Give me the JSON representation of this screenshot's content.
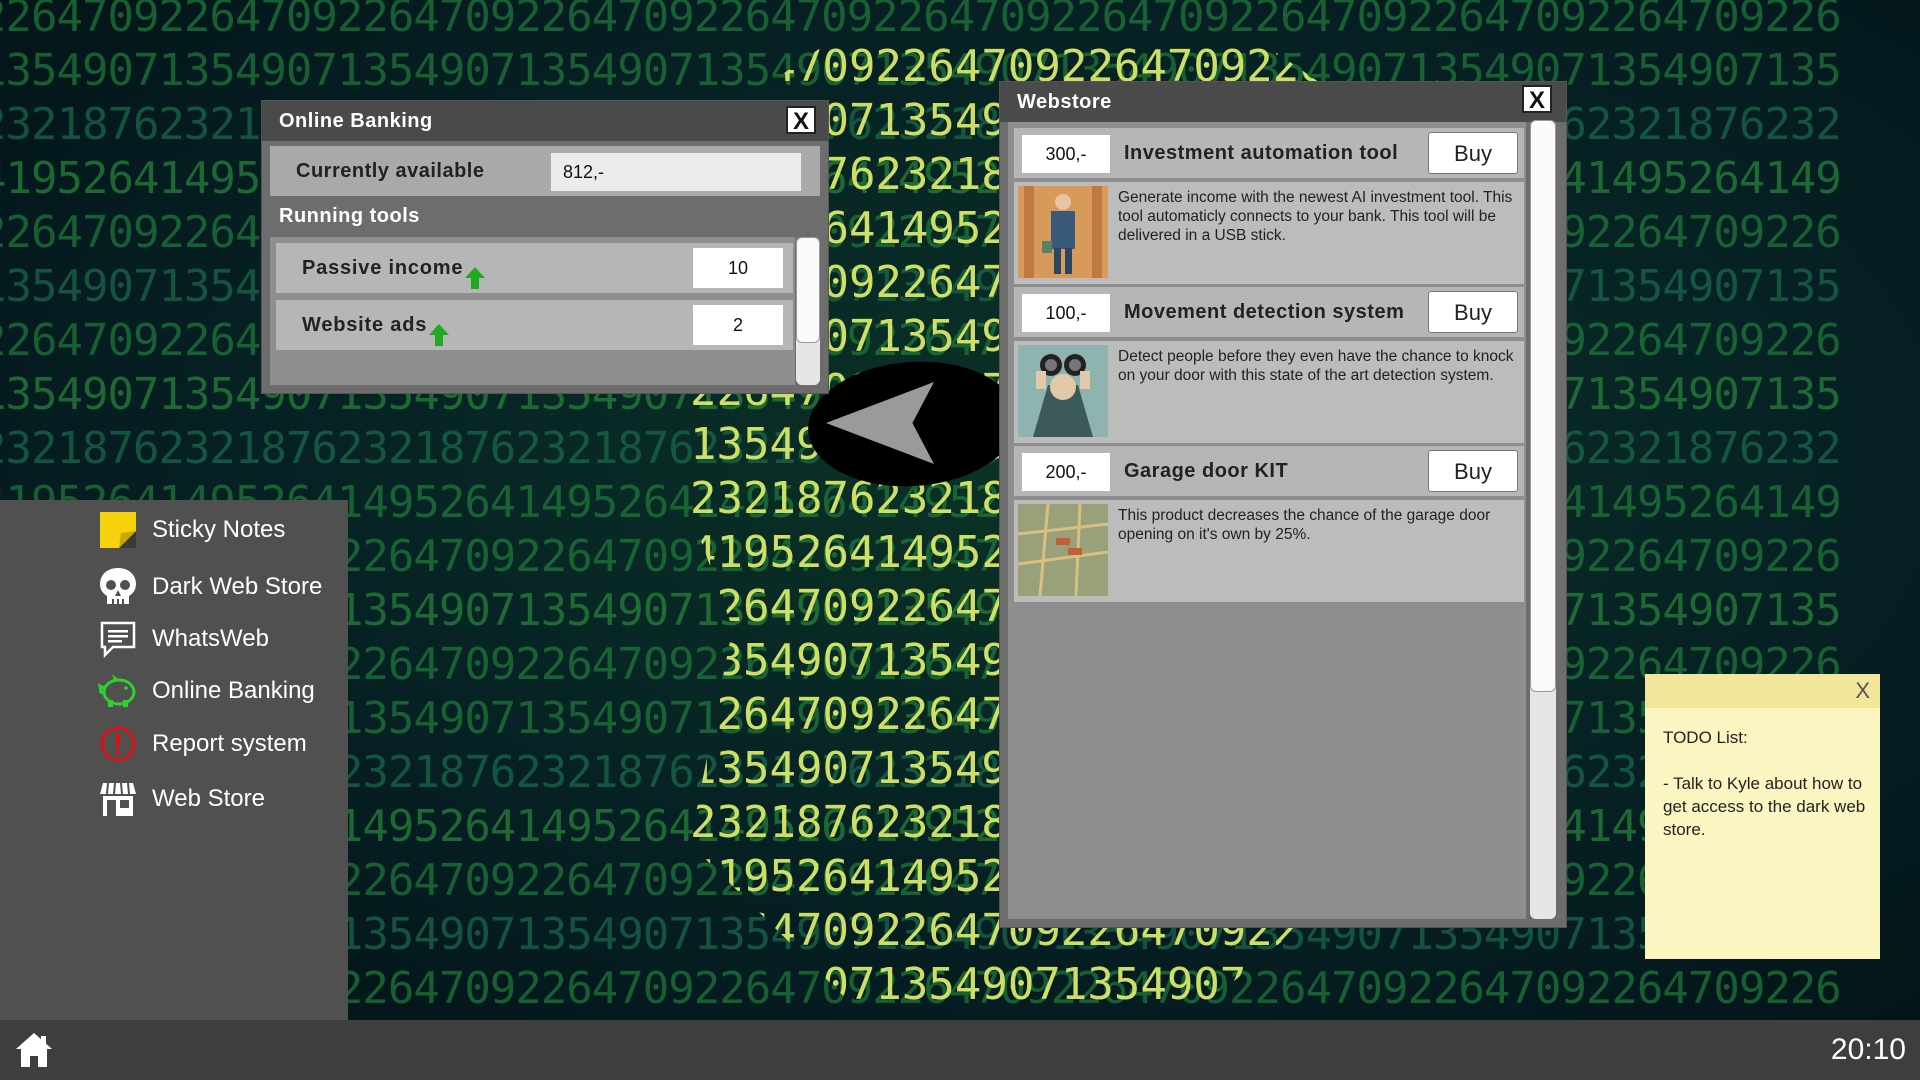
{
  "background": {
    "digits": [
      "2264709226470922647092264709226470922647092264709226470922647092264709226",
      "1354907135490713549071354907135490713549071354907135490713549071354907135",
      "2321876232187623218762321876232187623218762321876232187623218762321876232",
      "4195264149526414952641495264149526414952641495264149526414952641495264149",
      "2264709226470922647092264709226470922647092264709226470922647092264709226",
      "1354907135490713549071354907135490713549071354907135490713549071354907135"
    ]
  },
  "banking": {
    "title": "Online Banking",
    "close": "X",
    "available_label": "Currently available",
    "available_value": "812,-",
    "running_title": "Running tools",
    "tools": [
      {
        "name": "Passive income",
        "value": "10"
      },
      {
        "name": "Website ads",
        "value": "2"
      }
    ]
  },
  "webstore": {
    "title": "Webstore",
    "close": "X",
    "products": [
      {
        "price": "300,-",
        "name": "Investment automation tool",
        "buy": "Buy",
        "desc": "Generate income with the newest AI investment tool. This tool automaticly connects to your bank. This tool will be delivered in a USB stick."
      },
      {
        "price": "100,-",
        "name": "Movement detection system",
        "buy": "Buy",
        "desc": "Detect people before they even have the chance to knock on your door with this state of the art detection system."
      },
      {
        "price": "200,-",
        "name": "Garage door KIT",
        "buy": "Buy",
        "desc": "This product decreases the chance of the garage door opening on it's own by 25%."
      }
    ]
  },
  "sidebar": {
    "items": [
      {
        "label": "Sticky Notes",
        "icon": "sticky-note-icon"
      },
      {
        "label": "Dark Web Store",
        "icon": "skull-icon"
      },
      {
        "label": "WhatsWeb",
        "icon": "chat-icon"
      },
      {
        "label": "Online Banking",
        "icon": "piggy-bank-icon"
      },
      {
        "label": "Report system",
        "icon": "alert-icon"
      },
      {
        "label": "Web Store",
        "icon": "store-icon"
      }
    ]
  },
  "sticky": {
    "close": "X",
    "text": "TODO List:\n\n- Talk to Kyle about how to get access to the dark web store."
  },
  "taskbar": {
    "clock": "20:10",
    "home_icon": "home-icon"
  },
  "colors": {
    "arrow_green": "#1faa1f",
    "window_bg": "#6d6d6d",
    "titlebar_bg": "#4a4a4a",
    "sticky_bg": "#fbf5c1"
  }
}
